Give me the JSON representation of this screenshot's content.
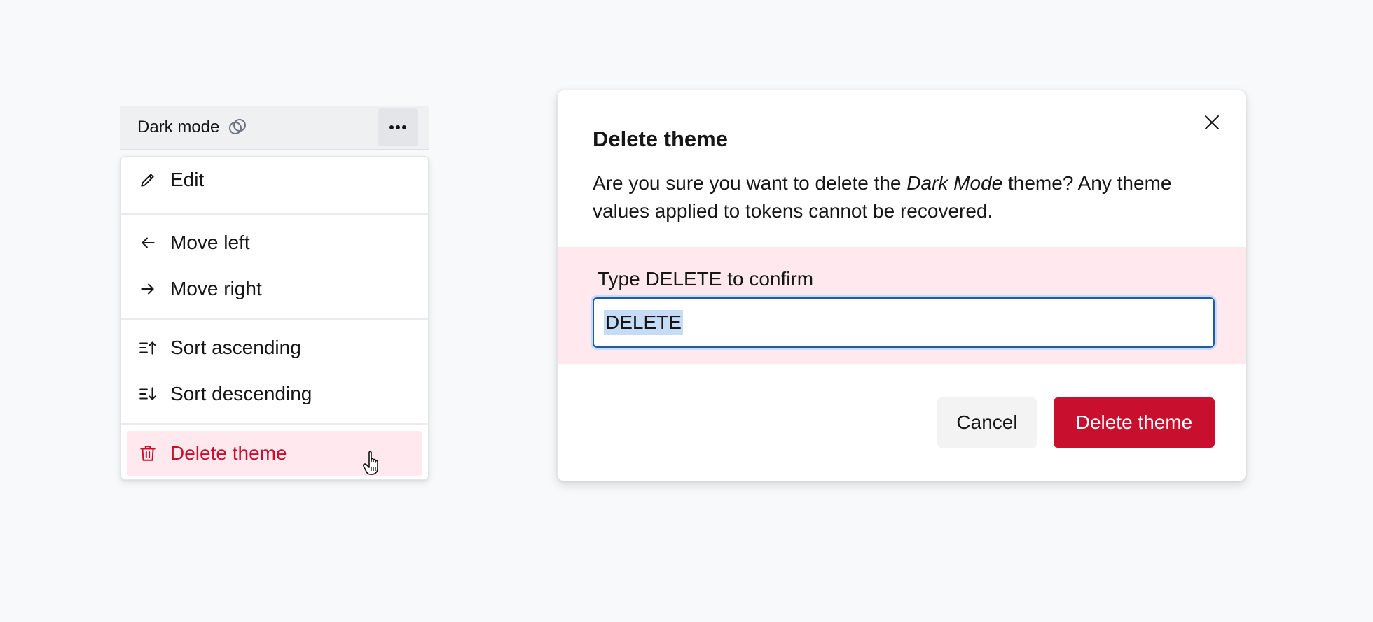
{
  "theme_tab": {
    "label": "Dark mode",
    "icon": "linked-circles-icon",
    "more_icon": "more-horizontal-icon"
  },
  "menu": {
    "items": [
      {
        "label": "Edit",
        "icon": "pencil-icon"
      },
      {
        "label": "Move left",
        "icon": "arrow-left-icon"
      },
      {
        "label": "Move right",
        "icon": "arrow-right-icon"
      },
      {
        "label": "Sort ascending",
        "icon": "sort-ascending-icon"
      },
      {
        "label": "Sort descending",
        "icon": "sort-descending-icon"
      },
      {
        "label": "Delete theme",
        "icon": "trash-icon"
      }
    ]
  },
  "modal": {
    "title": "Delete theme",
    "body_before": "Are you sure you want to delete the ",
    "body_theme_name": "Dark Mode",
    "body_after": " theme? Any theme values applied to tokens cannot be recovered.",
    "confirm_label": "Type DELETE to confirm",
    "confirm_value": "DELETE",
    "cancel_label": "Cancel",
    "delete_label": "Delete theme",
    "close_icon": "close-icon"
  },
  "colors": {
    "danger": "#c8102e",
    "danger_bg": "#ffe9ee",
    "focus": "#1f5aa6"
  }
}
